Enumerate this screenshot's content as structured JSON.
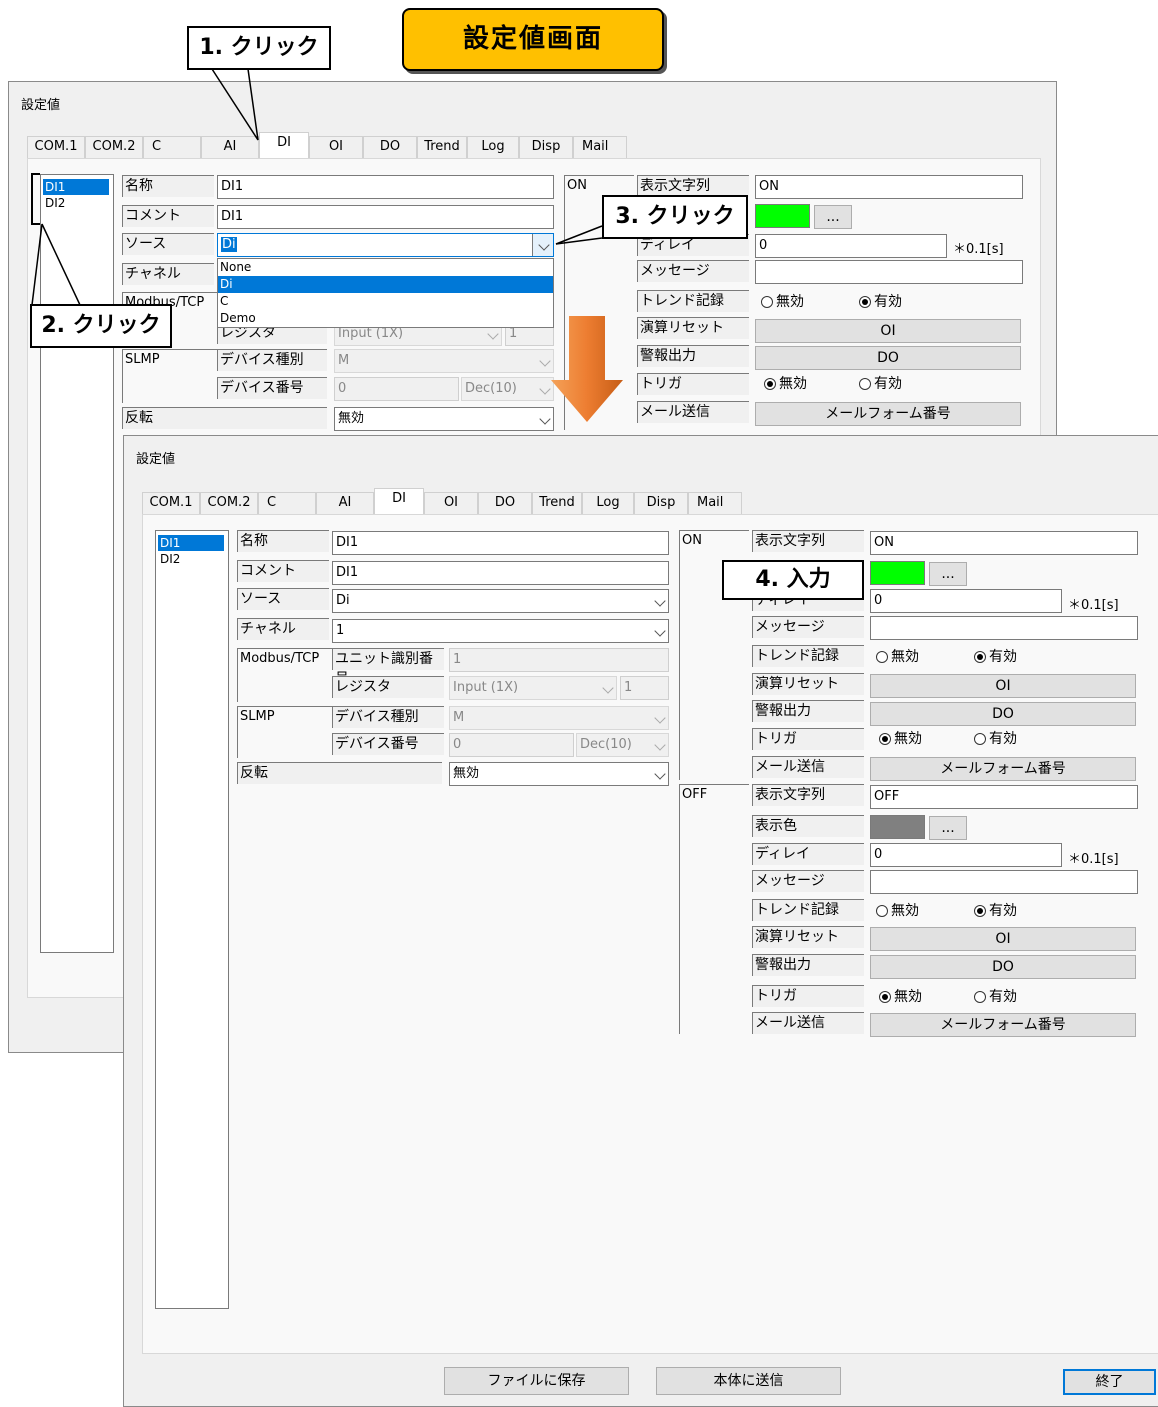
{
  "page_title": "設定値画面",
  "callouts": {
    "step1": "1. クリック",
    "step2": "2. クリック",
    "step3": "3. クリック",
    "step4": "4. 入力"
  },
  "colors": {
    "accent": "#0078d7",
    "title_banner": "#ffc000",
    "arrow": "#ed7d31",
    "on_color": "#00ff00",
    "off_color": "#808080"
  },
  "window_title": "設定値",
  "tabs": [
    "COM.1",
    "COM.2",
    "C",
    "AI",
    "DI",
    "OI",
    "DO",
    "Trend",
    "Log",
    "Disp",
    "Mail"
  ],
  "active_tab": "DI",
  "di_list": [
    "DI1",
    "DI2"
  ],
  "labels": {
    "name": "名称",
    "comment": "コメント",
    "source": "ソース",
    "channel": "チャネル",
    "modbus": "Modbus/TCP",
    "unit_id": "ユニット識別番号",
    "register": "レジスタ",
    "slmp": "SLMP",
    "device_type": "デバイス種別",
    "device_no": "デバイス番号",
    "invert": "反転",
    "display_text": "表示文字列",
    "display_color": "表示色",
    "delay": "ディレイ",
    "message": "メッセージ",
    "trend_record": "トレンド記録",
    "calc_reset": "演算リセット",
    "alarm_output": "警報出力",
    "trigger": "トリガ",
    "mail_send": "メール送信",
    "disabled": "無効",
    "enabled": "有効",
    "delay_unit": "＊0.1[s]",
    "on": "ON",
    "off": "OFF"
  },
  "back_window": {
    "name": "DI1",
    "comment": "DI1",
    "source": "Di",
    "source_options": [
      "None",
      "Di",
      "C",
      "Demo"
    ],
    "source_selected": "Di",
    "register": "Input (1X)",
    "register_no": "1",
    "device_type": "M",
    "device_no": "0",
    "device_fmt": "Dec(10)",
    "invert": "無効",
    "on_text": "ON",
    "on_delay": "0",
    "color_btn": "...",
    "oi_btn": "OI",
    "do_btn": "DO",
    "mail_btn": "メールフォーム番号"
  },
  "front_window": {
    "name": "DI1",
    "comment": "DI1",
    "source": "Di",
    "channel": "1",
    "unit_id": "1",
    "register": "Input (1X)",
    "register_no": "1",
    "device_type": "M",
    "device_no": "0",
    "device_fmt": "Dec(10)",
    "invert": "無効",
    "on": {
      "text": "ON",
      "delay": "0",
      "message": "",
      "trend": "enabled",
      "trigger": "disabled"
    },
    "off": {
      "text": "OFF",
      "delay": "0",
      "message": "",
      "trend": "enabled",
      "trigger": "disabled"
    },
    "color_btn": "...",
    "oi_btn": "OI",
    "do_btn": "DO",
    "mail_btn": "メールフォーム番号"
  },
  "footer": {
    "save_file": "ファイルに保存",
    "send_device": "本体に送信",
    "close": "終了"
  }
}
